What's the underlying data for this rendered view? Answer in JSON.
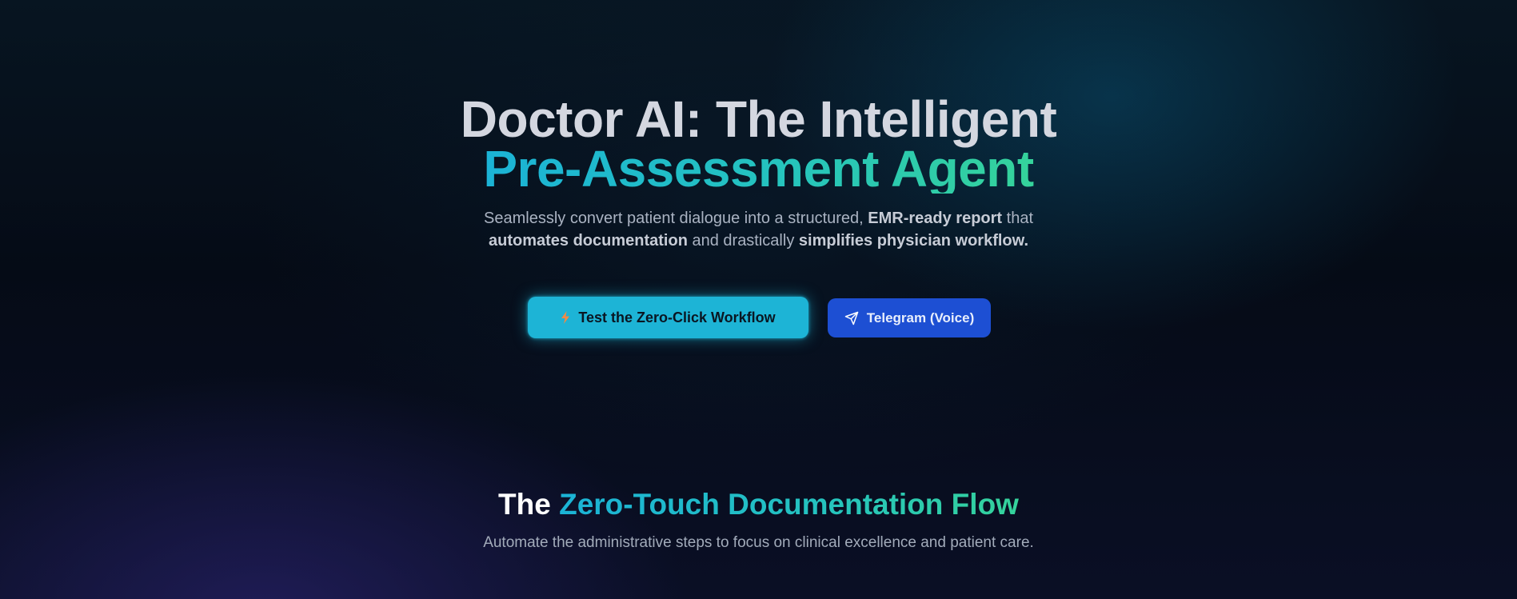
{
  "hero": {
    "title_line1": "Doctor AI: The Intelligent",
    "title_line2": "Pre-Assessment Agent",
    "subtitle": {
      "part1": "Seamlessly convert patient dialogue into a structured, ",
      "bold1": "EMR-ready report",
      "part2": " that ",
      "bold2": "automates documentation",
      "part3": " and drastically ",
      "bold3": "simplifies physician workflow."
    }
  },
  "cta": {
    "primary_label": "Test the Zero-Click Workflow",
    "primary_icon": "lightning-icon",
    "secondary_label": "Telegram (Voice)",
    "secondary_icon": "paper-plane-icon"
  },
  "section": {
    "title_plain": "The ",
    "title_highlight": "Zero-Touch Documentation Flow",
    "subtitle": "Automate the administrative steps to focus on clinical excellence and patient care."
  },
  "colors": {
    "accent_cyan": "#1db4d6",
    "accent_green": "#35d39b",
    "button_blue": "#1d4fd3",
    "background": "#050b14"
  }
}
